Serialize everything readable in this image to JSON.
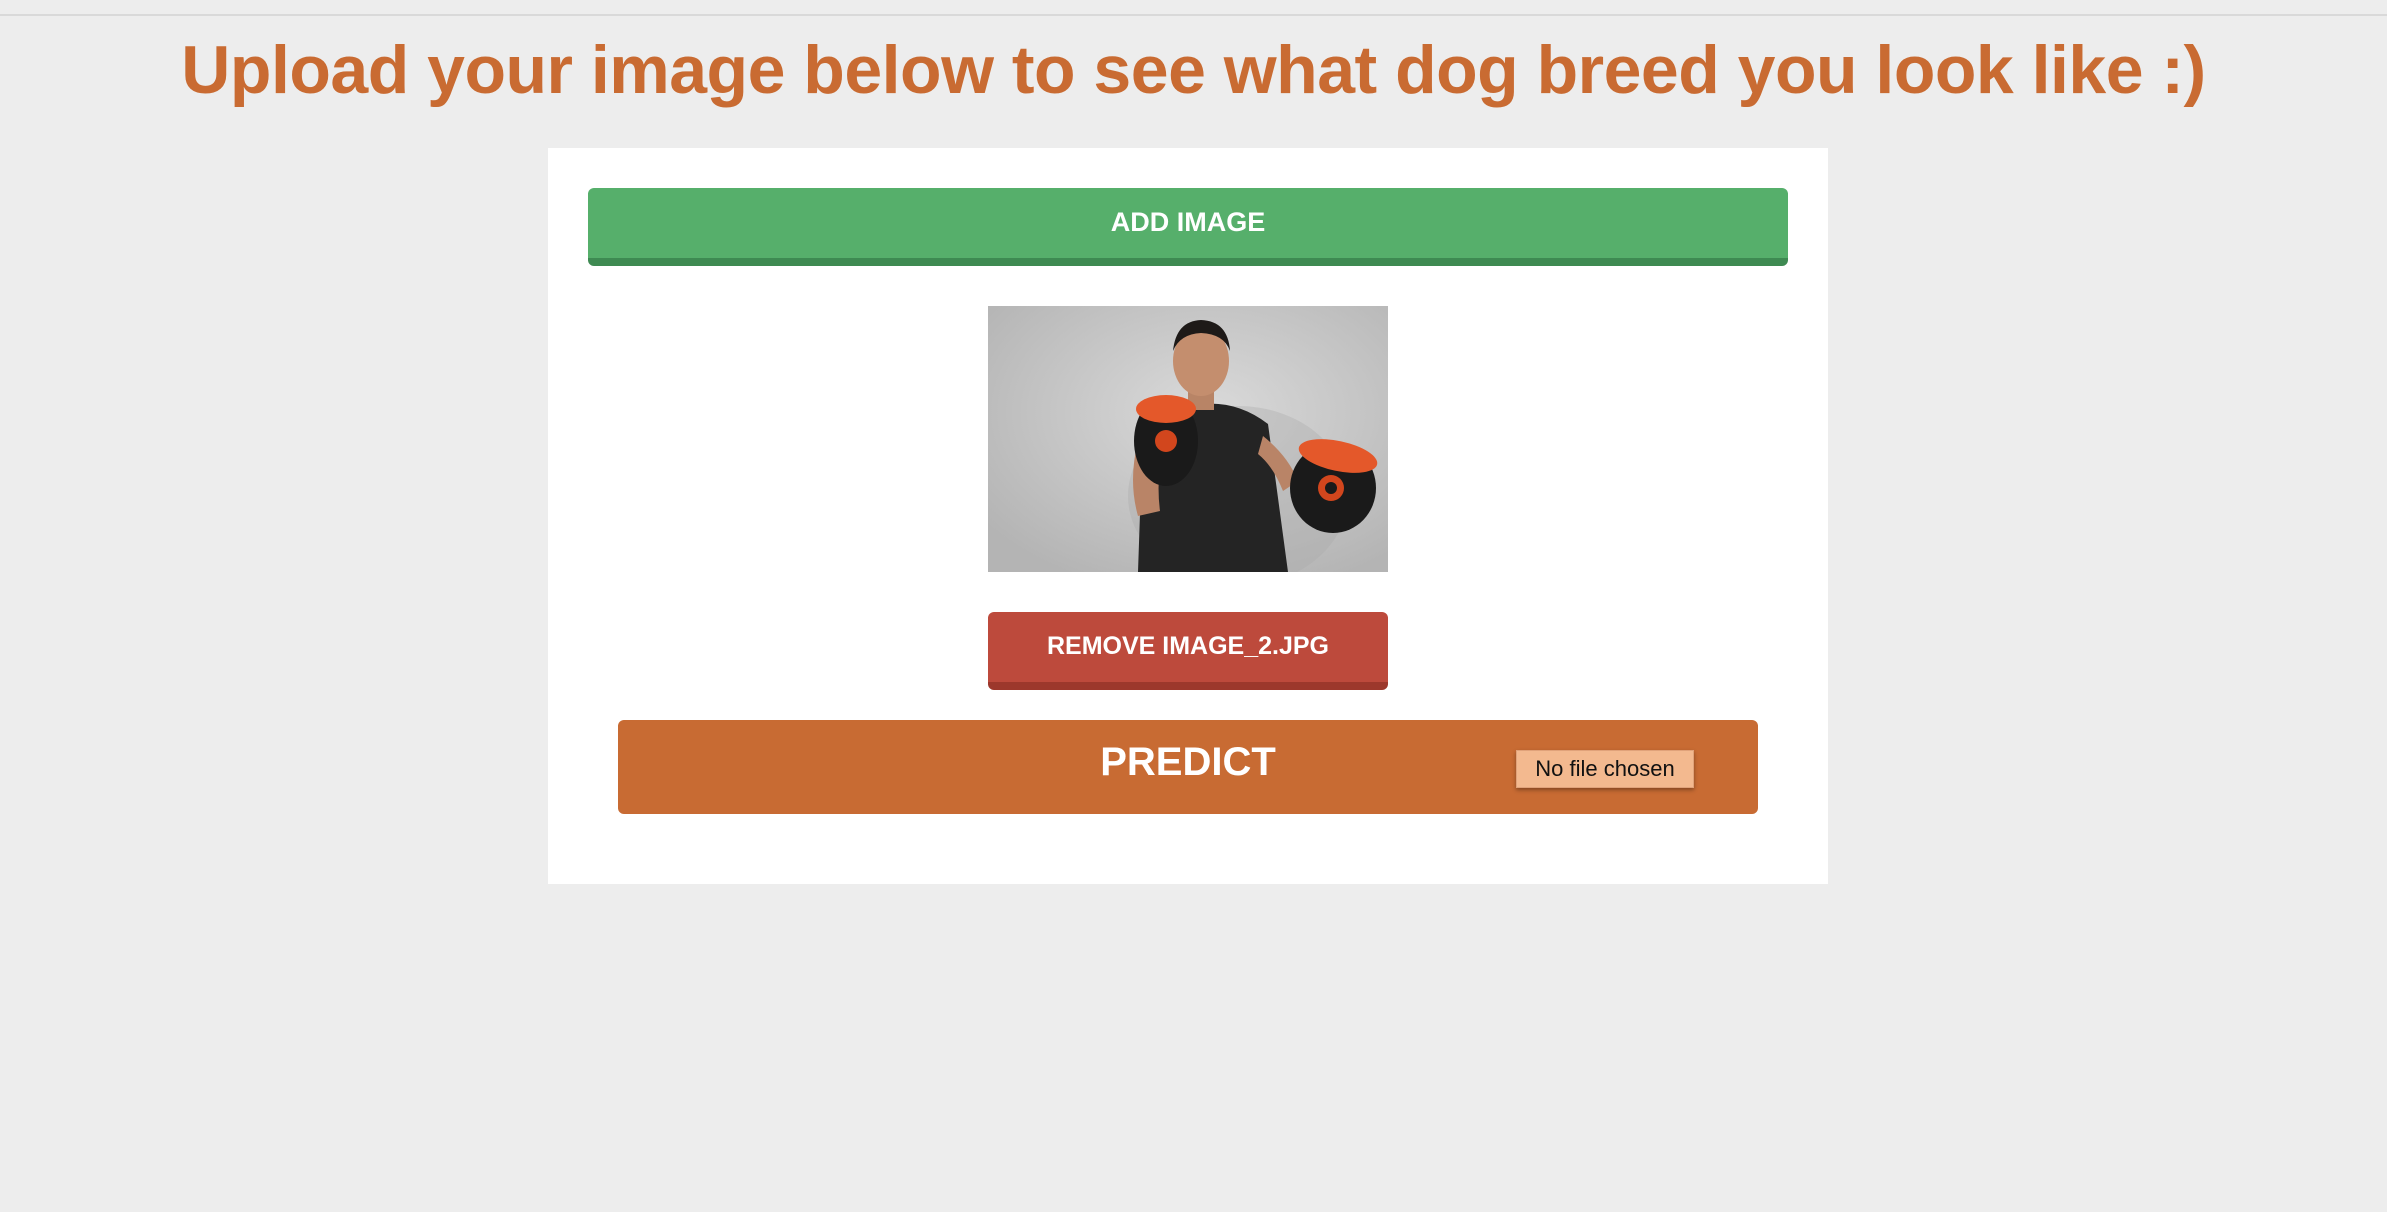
{
  "page": {
    "heading": "Upload your image below to see what dog breed you look like :)"
  },
  "uploader": {
    "add_button_label": "ADD IMAGE",
    "remove_button_label": "REMOVE IMAGE_2.JPG",
    "predict_label": "PREDICT",
    "file_status": "No file chosen"
  },
  "colors": {
    "heading": "#c96b32",
    "add_button": "#56af6b",
    "remove_button": "#bd4a3c",
    "predict_button": "#c86b33",
    "file_chip": "#f3b98f"
  }
}
